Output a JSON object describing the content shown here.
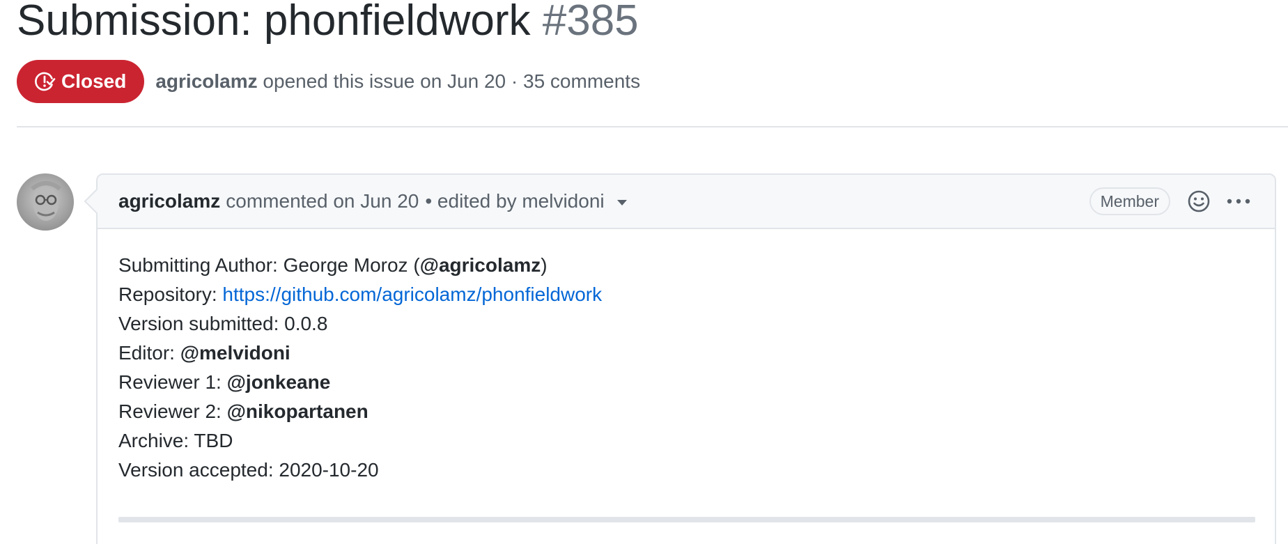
{
  "issue": {
    "title": "Submission: phonfieldwork",
    "number": "#385",
    "state": "Closed",
    "author": "agricolamz",
    "opened_text": "opened this issue on Jun 20 · 35 comments"
  },
  "comment": {
    "author": "agricolamz",
    "commented_text": "commented on Jun 20",
    "edited_text": "• edited by melvidoni",
    "member_label": "Member",
    "icons": {
      "reaction": "smiley-icon",
      "more": "kebab-horizontal-icon",
      "state": "issue-closed-icon",
      "caret": "caret-down-icon"
    },
    "body": {
      "author_label": "Submitting Author: George Moroz (",
      "author_mention": "@agricolamz",
      "author_close": ")",
      "repo_label": "Repository: ",
      "repo_url": "https://github.com/agricolamz/phonfieldwork",
      "version_submitted": "Version submitted: 0.0.8",
      "editor_label": "Editor: ",
      "editor_mention": "@melvidoni",
      "reviewer1_label": "Reviewer 1: ",
      "reviewer1_mention": "@jonkeane",
      "reviewer2_label": "Reviewer 2: ",
      "reviewer2_mention": "@nikopartanen",
      "archive": "Archive: TBD",
      "version_accepted": "Version accepted: 2020-10-20"
    }
  },
  "colors": {
    "closed_badge": "#cb2431",
    "link": "#0366d6",
    "muted_text": "#586069",
    "border": "#e1e4e8",
    "header_bg": "#f6f8fa"
  }
}
